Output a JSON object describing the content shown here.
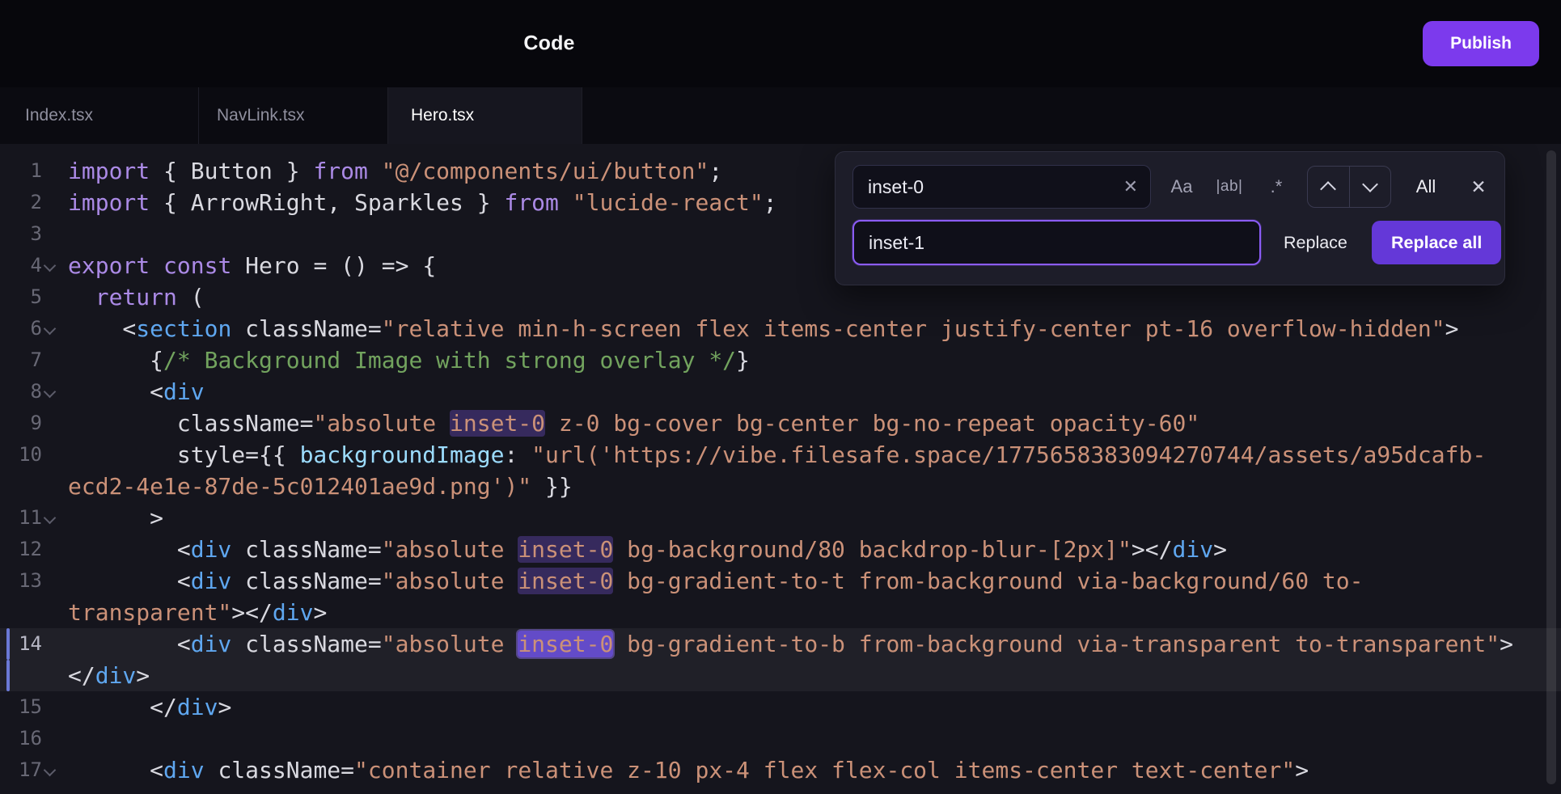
{
  "header": {
    "title": "Code",
    "publish_label": "Publish"
  },
  "tabs": [
    {
      "label": "Index.tsx",
      "active": false
    },
    {
      "label": "NavLink.tsx",
      "active": false
    },
    {
      "label": "Hero.tsx",
      "active": true
    }
  ],
  "find": {
    "search_value": "inset-0",
    "replace_value": "inset-1",
    "clear_icon": "✕",
    "match_case_label": "Aa",
    "whole_word_label": "|ab|",
    "regex_label": ".*",
    "all_label": "All",
    "close_icon": "✕",
    "replace_label": "Replace",
    "replace_all_label": "Replace all"
  },
  "colors": {
    "accent_publish": "#7c3aed",
    "accent_replace_all": "#6438d8",
    "focus_border": "#8b5cf6",
    "match_highlight": "#7c58e6",
    "editor_bg": "#15151d",
    "keyword": "#ab8ae6",
    "tag": "#5fa7f0",
    "string": "#cb9178",
    "comment": "#72a35e",
    "property": "#9cdcfe"
  },
  "code": {
    "lines": [
      {
        "n": "1",
        "rows": [
          [
            {
              "c": "k",
              "v": "import"
            },
            {
              "c": "p",
              "v": " { Button } "
            },
            {
              "c": "k",
              "v": "from"
            },
            {
              "c": "p",
              "v": " "
            },
            {
              "c": "s",
              "v": "\"@/components/ui/button\""
            },
            {
              "c": "p",
              "v": ";"
            }
          ]
        ]
      },
      {
        "n": "2",
        "rows": [
          [
            {
              "c": "k",
              "v": "import"
            },
            {
              "c": "p",
              "v": " { ArrowRight, Sparkles } "
            },
            {
              "c": "k",
              "v": "from"
            },
            {
              "c": "p",
              "v": " "
            },
            {
              "c": "s",
              "v": "\"lucide-react\""
            },
            {
              "c": "p",
              "v": ";"
            }
          ]
        ]
      },
      {
        "n": "3",
        "rows": [
          []
        ]
      },
      {
        "n": "4",
        "fold": true,
        "rows": [
          [
            {
              "c": "k",
              "v": "export"
            },
            {
              "c": "p",
              "v": " "
            },
            {
              "c": "k",
              "v": "const"
            },
            {
              "c": "p",
              "v": " Hero = () => {"
            }
          ]
        ]
      },
      {
        "n": "5",
        "rows": [
          [
            {
              "c": "p",
              "v": "  "
            },
            {
              "c": "k",
              "v": "return"
            },
            {
              "c": "p",
              "v": " ("
            }
          ]
        ]
      },
      {
        "n": "6",
        "fold": true,
        "rows": [
          [
            {
              "c": "p",
              "v": "    <"
            },
            {
              "c": "t",
              "v": "section"
            },
            {
              "c": "p",
              "v": " className="
            },
            {
              "c": "s",
              "v": "\"relative min-h-screen flex items-center justify-center pt-16 overflow-hidden\""
            },
            {
              "c": "p",
              "v": ">"
            }
          ]
        ]
      },
      {
        "n": "7",
        "rows": [
          [
            {
              "c": "p",
              "v": "      {"
            },
            {
              "c": "cm",
              "v": "/* Background Image with strong overlay */"
            },
            {
              "c": "p",
              "v": "}"
            }
          ]
        ]
      },
      {
        "n": "8",
        "fold": true,
        "rows": [
          [
            {
              "c": "p",
              "v": "      <"
            },
            {
              "c": "t",
              "v": "div"
            }
          ]
        ]
      },
      {
        "n": "9",
        "rows": [
          [
            {
              "c": "p",
              "v": "        className="
            },
            {
              "c": "s",
              "v": "\"absolute "
            },
            {
              "c": "s",
              "v": "inset-0",
              "m": "hl"
            },
            {
              "c": "s",
              "v": " z-0 bg-cover bg-center bg-no-repeat opacity-60\""
            }
          ]
        ]
      },
      {
        "n": "10",
        "rows": [
          [
            {
              "c": "p",
              "v": "        style={{ "
            },
            {
              "c": "pr",
              "v": "backgroundImage"
            },
            {
              "c": "p",
              "v": ": "
            },
            {
              "c": "s",
              "v": "\"url('https://vibe.filesafe.space/1775658383094270744/assets/a95dcafb-"
            }
          ],
          [
            {
              "c": "s",
              "v": "ecd2-4e1e-87de-5c012401ae9d.png')\""
            },
            {
              "c": "p",
              "v": " }}"
            }
          ]
        ]
      },
      {
        "n": "11",
        "fold": true,
        "rows": [
          [
            {
              "c": "p",
              "v": "      >"
            }
          ]
        ]
      },
      {
        "n": "12",
        "rows": [
          [
            {
              "c": "p",
              "v": "        <"
            },
            {
              "c": "t",
              "v": "div"
            },
            {
              "c": "p",
              "v": " className="
            },
            {
              "c": "s",
              "v": "\"absolute "
            },
            {
              "c": "s",
              "v": "inset-0",
              "m": "hl"
            },
            {
              "c": "s",
              "v": " bg-background/80 backdrop-blur-[2px]\""
            },
            {
              "c": "p",
              "v": "></"
            },
            {
              "c": "t",
              "v": "div"
            },
            {
              "c": "p",
              "v": ">"
            }
          ]
        ]
      },
      {
        "n": "13",
        "rows": [
          [
            {
              "c": "p",
              "v": "        <"
            },
            {
              "c": "t",
              "v": "div"
            },
            {
              "c": "p",
              "v": " className="
            },
            {
              "c": "s",
              "v": "\"absolute "
            },
            {
              "c": "s",
              "v": "inset-0",
              "m": "hl"
            },
            {
              "c": "s",
              "v": " bg-gradient-to-t from-background via-background/60 to-"
            }
          ],
          [
            {
              "c": "s",
              "v": "transparent\""
            },
            {
              "c": "p",
              "v": "></"
            },
            {
              "c": "t",
              "v": "div"
            },
            {
              "c": "p",
              "v": ">"
            }
          ]
        ]
      },
      {
        "n": "14",
        "cur": true,
        "rows": [
          [
            {
              "c": "p",
              "v": "        <"
            },
            {
              "c": "t",
              "v": "div"
            },
            {
              "c": "p",
              "v": " className="
            },
            {
              "c": "s",
              "v": "\"absolute "
            },
            {
              "c": "s",
              "v": "inset-0",
              "m": "cur"
            },
            {
              "c": "s",
              "v": " bg-gradient-to-b from-background via-transparent to-transparent\""
            },
            {
              "c": "p",
              "v": ">"
            }
          ],
          [
            {
              "c": "p",
              "v": "</"
            },
            {
              "c": "t",
              "v": "div"
            },
            {
              "c": "p",
              "v": ">"
            }
          ]
        ]
      },
      {
        "n": "15",
        "rows": [
          [
            {
              "c": "p",
              "v": "      </"
            },
            {
              "c": "t",
              "v": "div"
            },
            {
              "c": "p",
              "v": ">"
            }
          ]
        ]
      },
      {
        "n": "16",
        "rows": [
          []
        ]
      },
      {
        "n": "17",
        "fold": true,
        "rows": [
          [
            {
              "c": "p",
              "v": "      <"
            },
            {
              "c": "t",
              "v": "div"
            },
            {
              "c": "p",
              "v": " className="
            },
            {
              "c": "s",
              "v": "\"container relative z-10 px-4 flex flex-col items-center text-center\""
            },
            {
              "c": "p",
              "v": ">"
            }
          ]
        ]
      }
    ]
  }
}
